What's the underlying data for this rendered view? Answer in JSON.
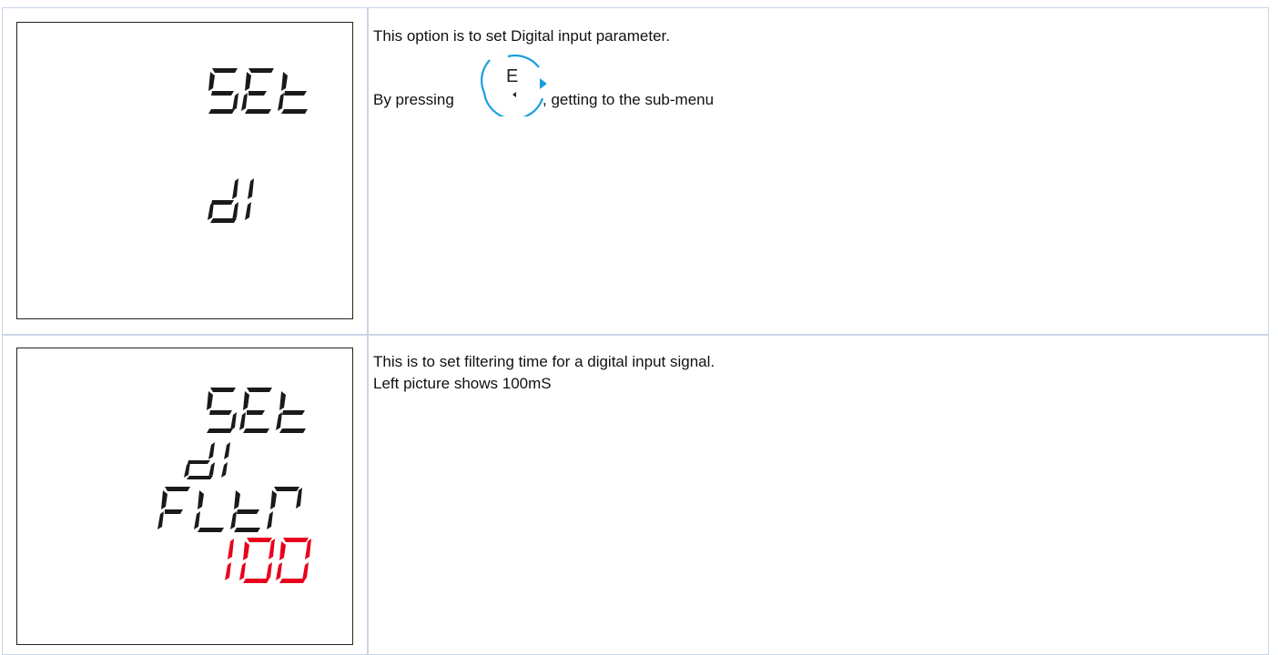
{
  "rows": [
    {
      "display_lines": [
        "SEt",
        "dI"
      ],
      "text_line_1": "This option is to set Digital input parameter.",
      "text_line_2_before": "By pressing",
      "text_line_2_after": ", getting to the sub-menu",
      "button_label": "E"
    },
    {
      "display_lines": [
        "SEt",
        "dI",
        "FLtr"
      ],
      "display_value": "100",
      "text_line_1": "This is to set filtering time for a digital input signal.",
      "text_line_2": "Left picture shows 100mS"
    }
  ],
  "colors": {
    "border": "#c9d5e6",
    "value_red": "#e8001c",
    "button_blue": "#1a9ee0"
  }
}
